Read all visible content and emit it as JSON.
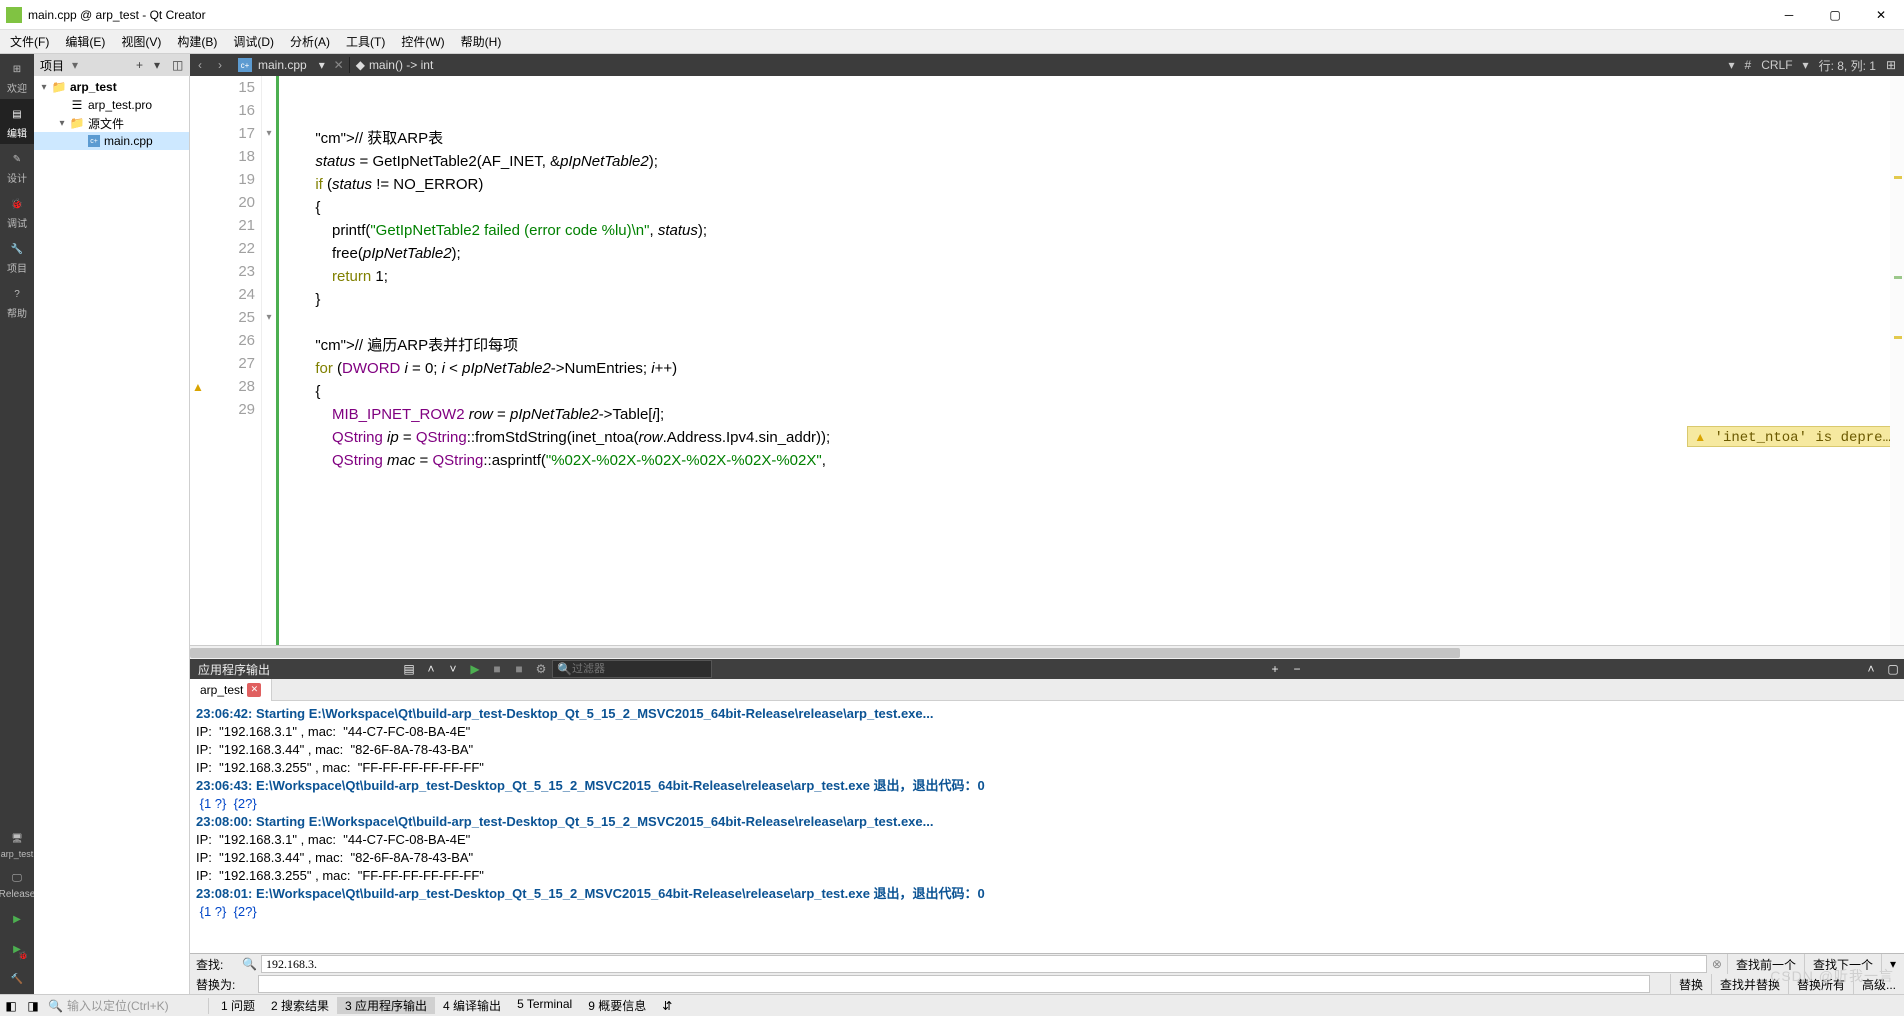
{
  "window": {
    "title": "main.cpp @ arp_test - Qt Creator"
  },
  "menu": [
    "文件(F)",
    "编辑(E)",
    "视图(V)",
    "构建(B)",
    "调试(D)",
    "分析(A)",
    "工具(T)",
    "控件(W)",
    "帮助(H)"
  ],
  "leftbar": [
    {
      "label": "欢迎",
      "active": false
    },
    {
      "label": "编辑",
      "active": true
    },
    {
      "label": "设计",
      "active": false
    },
    {
      "label": "调试",
      "active": false
    },
    {
      "label": "项目",
      "active": false
    },
    {
      "label": "帮助",
      "active": false
    }
  ],
  "leftbar_bottom": [
    "arp_test",
    "",
    "Release"
  ],
  "project_toolbar": {
    "label": "项目"
  },
  "tree": {
    "root": {
      "name": "arp_test",
      "expanded": true
    },
    "pro": "arp_test.pro",
    "folder": {
      "name": "源文件",
      "expanded": true
    },
    "file": "main.cpp"
  },
  "editor_tabs": {
    "file": "main.cpp",
    "breadcrumb": "main() -> int"
  },
  "status_right": {
    "encoding": "#",
    "lineend": "CRLF",
    "pos": "行: 8, 列: 1"
  },
  "code_lines": {
    "start": 15,
    "lines": [
      "        // 获取ARP表",
      "        status = GetIpNetTable2(AF_INET, &pIpNetTable2);",
      "        if (status != NO_ERROR)",
      "        {",
      "            printf(\"GetIpNetTable2 failed (error code %lu)\\n\", status);",
      "            free(pIpNetTable2);",
      "            return 1;",
      "        }",
      "",
      "        // 遍历ARP表并打印每项",
      "        for (DWORD i = 0; i < pIpNetTable2->NumEntries; i++)",
      "        {",
      "            MIB_IPNET_ROW2 row = pIpNetTable2->Table[i];",
      "            QString ip = QString::fromStdString(inet_ntoa(row.Address.Ipv4.sin_addr));",
      "            QString mac = QString::asprintf(\"%02X-%02X-%02X-%02X-%02X-%02X\","
    ],
    "fold_at": [
      17,
      25
    ],
    "warn_at": 28,
    "warn_text": "'inet_ntoa' is depre…"
  },
  "output_header": {
    "title": "应用程序输出",
    "filter_placeholder": "过滤器"
  },
  "out_tab": {
    "name": "arp_test"
  },
  "output_lines": [
    {
      "t": "23:06:42: Starting E:\\Workspace\\Qt\\build-arp_test-Desktop_Qt_5_15_2_MSVC2015_64bit-Release\\release\\arp_test.exe...",
      "cls": "blue"
    },
    {
      "t": "IP:  \"192.168.3.1\" , mac:  \"44-C7-FC-08-BA-4E\"",
      "cls": "dim"
    },
    {
      "t": "IP:  \"192.168.3.44\" , mac:  \"82-6F-8A-78-43-BA\"",
      "cls": "dim"
    },
    {
      "t": "IP:  \"192.168.3.255\" , mac:  \"FF-FF-FF-FF-FF-FF\"",
      "cls": "dim"
    },
    {
      "t": "23:06:43: E:\\Workspace\\Qt\\build-arp_test-Desktop_Qt_5_15_2_MSVC2015_64bit-Release\\release\\arp_test.exe 退出，退出代码：0",
      "cls": "blue"
    },
    {
      "t": " {1 ?}  {2?}",
      "cls": "hl"
    },
    {
      "t": "",
      "cls": ""
    },
    {
      "t": "23:08:00: Starting E:\\Workspace\\Qt\\build-arp_test-Desktop_Qt_5_15_2_MSVC2015_64bit-Release\\release\\arp_test.exe...",
      "cls": "blue"
    },
    {
      "t": "IP:  \"192.168.3.1\" , mac:  \"44-C7-FC-08-BA-4E\"",
      "cls": "dim"
    },
    {
      "t": "IP:  \"192.168.3.44\" , mac:  \"82-6F-8A-78-43-BA\"",
      "cls": "dim"
    },
    {
      "t": "IP:  \"192.168.3.255\" , mac:  \"FF-FF-FF-FF-FF-FF\"",
      "cls": "dim"
    },
    {
      "t": "23:08:01: E:\\Workspace\\Qt\\build-arp_test-Desktop_Qt_5_15_2_MSVC2015_64bit-Release\\release\\arp_test.exe 退出，退出代码：0",
      "cls": "blue"
    },
    {
      "t": " {1 ?}  {2?}",
      "cls": "hl"
    }
  ],
  "find": {
    "find_label": "查找:",
    "replace_label": "替换为:",
    "search_value": "192.168.3.",
    "btns_top": [
      "查找前一个",
      "查找下一个"
    ],
    "btns_bot": [
      "替换",
      "查找并替换",
      "替换所有",
      "高级..."
    ]
  },
  "statusbar": {
    "search_placeholder": "输入以定位(Ctrl+K)",
    "tabs": [
      "1 问题",
      "2 搜索结果",
      "3 应用程序输出",
      "4 编译输出",
      "5 Terminal",
      "9 概要信息"
    ],
    "active": 2
  },
  "watermark": "CSDN @听我一言"
}
